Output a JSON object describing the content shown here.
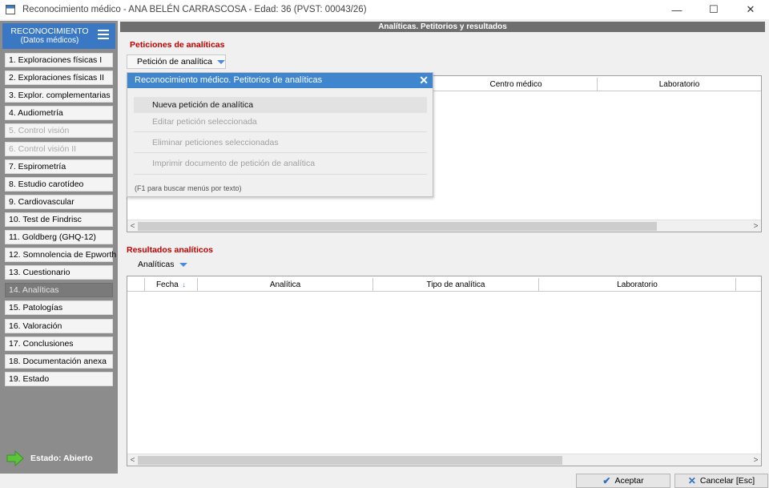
{
  "window": {
    "title": "Reconocimiento médico - ANA BELÉN CARRASCOSA  -  Edad: 36   (PVST: 00043/26)",
    "controls": [
      "—",
      "☐",
      "✕"
    ]
  },
  "sidebar": {
    "header_line1": "RECONOCIMIENTO",
    "header_line2": "(Datos médicos)",
    "items": [
      {
        "label": "1. Exploraciones físicas I",
        "state": "normal"
      },
      {
        "label": "2. Exploraciones físicas II",
        "state": "normal"
      },
      {
        "label": "3. Explor. complementarias",
        "state": "normal"
      },
      {
        "label": "4. Audiometría",
        "state": "normal"
      },
      {
        "label": "5. Control visión",
        "state": "disabled"
      },
      {
        "label": "6. Control visión II",
        "state": "disabled"
      },
      {
        "label": "7. Espirometría",
        "state": "normal"
      },
      {
        "label": "8. Estudio carotídeo",
        "state": "normal"
      },
      {
        "label": "9. Cardiovascular",
        "state": "normal"
      },
      {
        "label": "10. Test de Findrisc",
        "state": "normal"
      },
      {
        "label": "11. Goldberg (GHQ-12)",
        "state": "normal"
      },
      {
        "label": "12. Somnolencia de Epworth",
        "state": "normal"
      },
      {
        "label": "13. Cuestionario",
        "state": "normal"
      },
      {
        "label": "14. Analíticas",
        "state": "active"
      },
      {
        "label": "15. Patologías",
        "state": "normal"
      },
      {
        "label": "16. Valoración",
        "state": "normal"
      },
      {
        "label": "17. Conclusiones",
        "state": "normal"
      },
      {
        "label": "18. Documentación anexa",
        "state": "normal"
      },
      {
        "label": "19. Estado",
        "state": "normal"
      }
    ],
    "status_label": "Estado: Abierto"
  },
  "main": {
    "header": "Analíticas. Petitorios y resultados",
    "peticiones": {
      "title": "Peticiones de analíticas",
      "dropdown_label": "Petición de analítica",
      "columns": [
        "Centro médico",
        "Laboratorio"
      ]
    },
    "resultados": {
      "title": "Resultados analíticos",
      "dropdown_label": "Analíticas",
      "columns": [
        "Fecha",
        "Analítica",
        "Tipo de analítica",
        "Laboratorio"
      ]
    }
  },
  "popup": {
    "title": "Reconocimiento médico. Petitorios de analíticas",
    "items": [
      {
        "label": "Nueva petición de analítica",
        "enabled": true
      },
      {
        "label": "Editar petición seleccionada",
        "enabled": false
      },
      {
        "label": "Eliminar peticiones seleccionadas",
        "enabled": false
      },
      {
        "label": "Imprimir documento de petición de analítica",
        "enabled": false
      }
    ],
    "hint": "(F1 para buscar menús por texto)"
  },
  "buttons": {
    "accept": "Aceptar",
    "cancel": "Cancelar  [Esc]"
  },
  "colors": {
    "accent": "#3b78c4",
    "section_title": "#c00000",
    "sidebar_bg": "#8c8c8c"
  }
}
